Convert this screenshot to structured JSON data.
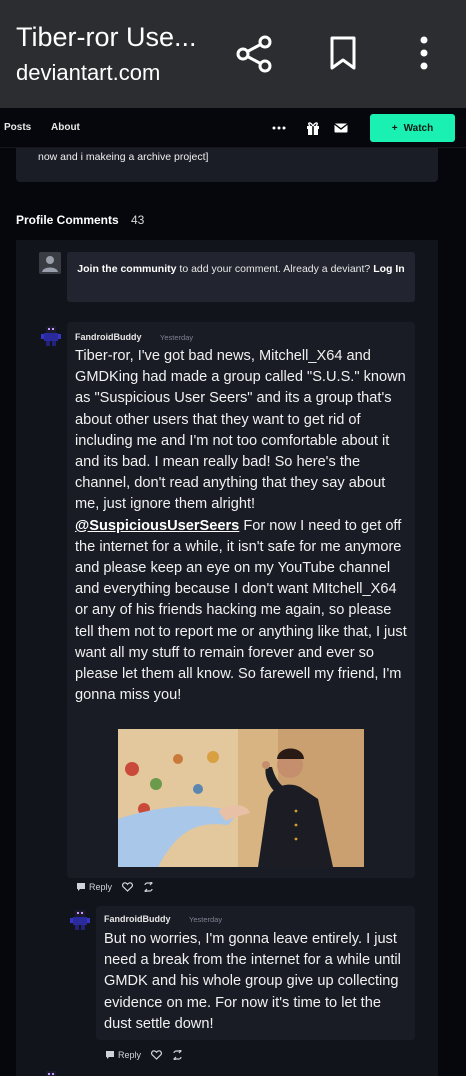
{
  "browser": {
    "title": "Tiber-ror Use...",
    "url": "deviantart.com",
    "share_icon": "share-icon",
    "bookmark_icon": "bookmark-icon",
    "more_icon": "more-vertical-icon"
  },
  "nav": {
    "tabs": [
      {
        "label": "Posts"
      },
      {
        "label": "About"
      }
    ],
    "more_icon": "ellipsis-icon",
    "gift_icon": "gift-icon",
    "mail_icon": "mail-icon",
    "watch_label": "Watch",
    "watch_color": "#1af0b2"
  },
  "top_card": {
    "text": "now and i makeing a archive project]"
  },
  "comments": {
    "title": "Profile Comments",
    "count": "43",
    "join_prompt": {
      "bold_start": "Join the community",
      "middle": " to add your comment. Already a deviant? ",
      "link": "Log In"
    },
    "items": [
      {
        "author": "FandroidBuddy",
        "time": "Yesterday",
        "body_before": "Tiber-ror, I've got bad news, Mitchell_X64 and GMDKing had made a group called \"S.U.S.\" known as \"Suspicious User Seers\" and its a group that's about other users that they want to get rid of including me and I'm not too comfortable about it and its bad. I mean really bad! So here's the channel, don't read anything that they say about me, just ignore them alright! ",
        "mention": "@SuspiciousUserSeers",
        "body_after": " For now I need to get off the internet for a while, it isn't safe for me anymore and please keep an eye on my YouTube channel and everything because I don't want MItchell_X64 or any of his friends hacking me again, so please tell them not to report me or anything like that, I just want all my stuff to remain forever and ever so please let them all know. So farewell my friend, I'm gonna miss you!",
        "reply_label": "Reply"
      },
      {
        "author": "FandroidBuddy",
        "time": "Yesterday",
        "body": "But no worries, I'm gonna leave entirely. I just need a break from the internet for a while until GMDK and his whole group give up collecting evidence on me. For now it's time to let the dust settle down!",
        "reply_label": "Reply"
      }
    ]
  }
}
